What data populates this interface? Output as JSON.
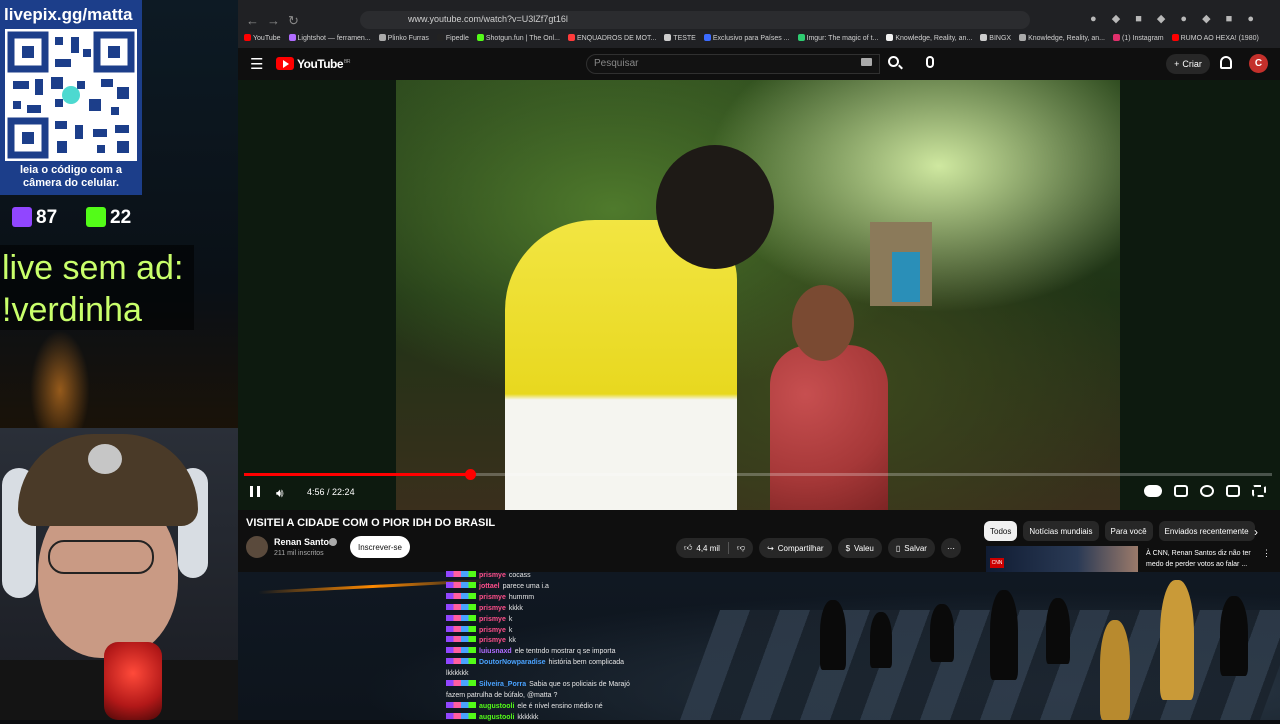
{
  "overlay": {
    "qr_title": "livepix.gg/matta",
    "qr_caption": "leia o código com a câmera do celular.",
    "twitch_count": "87",
    "kick_count": "22",
    "live_line1": "live sem ad:",
    "live_line2": "!verdinha"
  },
  "browser": {
    "url": "www.youtube.com/watch?v=U3lZf7gt16l",
    "bookmarks": [
      "YouTube",
      "Lightshot — ferramen...",
      "Plinko Furras",
      "Fipedle",
      "Shotgun.fun | The Onl...",
      "ENQUADROS DE MOT...",
      "TESTE",
      "Exclusivo para Países ...",
      "Imgur: The magic of t...",
      "Knowledge, Reality, an...",
      "BINGX",
      "Knowledge, Reality, an...",
      "(1) Instagram",
      "RUMO AO HEXA! (1980)"
    ],
    "bookmark_colors": [
      "#ff0000",
      "#b06cff",
      "#aaaaaa",
      "#222222",
      "#53fc18",
      "#ff3b3b",
      "#cccccc",
      "#3b6bff",
      "#2ecc71",
      "#f1f1f1",
      "#cccccc",
      "#aaaaaa",
      "#e1306c",
      "#ff0000"
    ]
  },
  "youtube": {
    "logo_text": "YouTube",
    "logo_region": "BR",
    "search_placeholder": "Pesquisar",
    "create_label": "Criar",
    "avatar_letter": "C",
    "player": {
      "time_current": "4:56",
      "time_total": "22:24",
      "progress_fraction": 0.22
    },
    "video_title": "VISITEI A CIDADE COM O PIOR IDH DO BRASIL",
    "channel_name": "Renan Santos",
    "channel_subs": "211 mil inscritos",
    "subscribe_label": "Inscrever-se",
    "like_count": "4,4 mil",
    "share_label": "Compartilhar",
    "thanks_label": "Valeu",
    "save_label": "Salvar",
    "chips": [
      "Todos",
      "Notícias mundiais",
      "Para você",
      "Enviados recentemente"
    ],
    "recommendation": {
      "title": "À CNN, Renan Santos diz não ter medo de perder votos ao falar ...",
      "badge": "CNN"
    }
  },
  "chat": [
    {
      "user": "prismye",
      "message": "cocass",
      "color": "#ff4f8b"
    },
    {
      "user": "jottael",
      "message": "parece uma i.a",
      "color": "#ff4f8b"
    },
    {
      "user": "prismye",
      "message": "hummm",
      "color": "#ff4f8b"
    },
    {
      "user": "prismye",
      "message": "kkkk",
      "color": "#ff4f8b"
    },
    {
      "user": "prismye",
      "message": "k",
      "color": "#ff4f8b"
    },
    {
      "user": "prismye",
      "message": "k",
      "color": "#ff4f8b"
    },
    {
      "user": "prismye",
      "message": "kk",
      "color": "#ff4f8b"
    },
    {
      "user": "luiusnaxd",
      "message": "ele tentndo mostrar q se importa",
      "color": "#b06cff"
    },
    {
      "user": "DoutorNowparadise",
      "message": "história bem complicada",
      "color": "#4aa3ff"
    },
    {
      "user": "",
      "message": "lkkkkkk",
      "color": "#ffffff"
    },
    {
      "user": "Silveira_Porra",
      "message": "Sabia que os policiais de Marajó",
      "color": "#4aa3ff"
    },
    {
      "user": "",
      "message": "fazem patrulha de búfalo, @matta ?",
      "color": "#ffffff"
    },
    {
      "user": "augustooli",
      "message": "ele é nível ensino médio né",
      "color": "#53fc18"
    },
    {
      "user": "augustooli",
      "message": "kkkkkk",
      "color": "#53fc18"
    }
  ]
}
